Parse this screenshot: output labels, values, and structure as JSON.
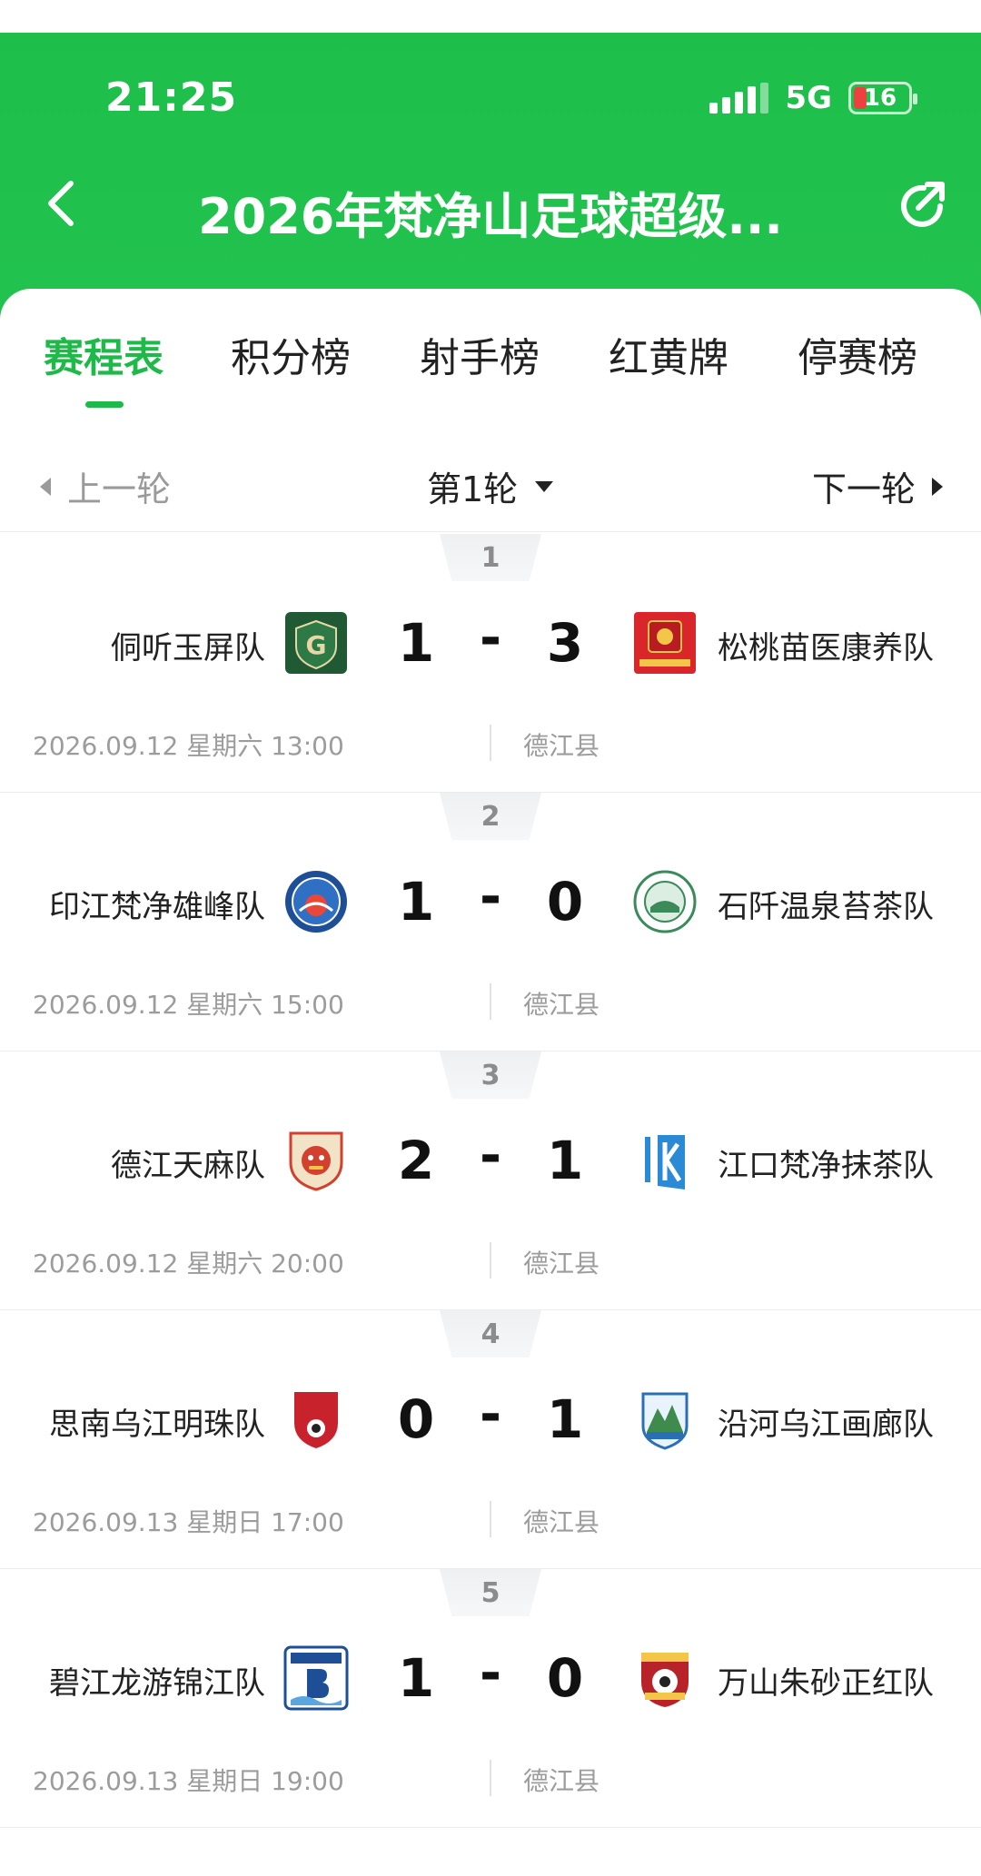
{
  "status_bar": {
    "time": "21:25",
    "network": "5G",
    "battery": "16"
  },
  "nav": {
    "title": "2026年梵净山足球超级..."
  },
  "tabs": [
    {
      "label": "赛程表",
      "active": true
    },
    {
      "label": "积分榜",
      "active": false
    },
    {
      "label": "射手榜",
      "active": false
    },
    {
      "label": "红黄牌",
      "active": false
    },
    {
      "label": "停赛榜",
      "active": false
    }
  ],
  "round_nav": {
    "prev": "上一轮",
    "current": "第1轮",
    "next": "下一轮"
  },
  "matches": [
    {
      "no": "1",
      "home": "侗听玉屏队",
      "home_score": "1",
      "dash": "-",
      "away_score": "3",
      "away": "松桃苗医康养队",
      "datetime": "2026.09.12 星期六 13:00",
      "venue": "德江县",
      "home_logo": "green-crest-icon",
      "away_logo": "red-banner-icon"
    },
    {
      "no": "2",
      "home": "印江梵净雄峰队",
      "home_score": "1",
      "dash": "-",
      "away_score": "0",
      "away": "石阡温泉苔茶队",
      "datetime": "2026.09.12 星期六 15:00",
      "venue": "德江县",
      "home_logo": "blue-round-badge-icon",
      "away_logo": "green-round-badge-icon"
    },
    {
      "no": "3",
      "home": "德江天麻队",
      "home_score": "2",
      "dash": "-",
      "away_score": "1",
      "away": "江口梵净抹茶队",
      "datetime": "2026.09.12 星期六 20:00",
      "venue": "德江县",
      "home_logo": "lion-shield-icon",
      "away_logo": "blue-k-icon"
    },
    {
      "no": "4",
      "home": "思南乌江明珠队",
      "home_score": "0",
      "dash": "-",
      "away_score": "1",
      "away": "沿河乌江画廊队",
      "datetime": "2026.09.13 星期日 17:00",
      "venue": "德江县",
      "home_logo": "cfa-shield-icon",
      "away_logo": "mountain-shield-icon"
    },
    {
      "no": "5",
      "home": "碧江龙游锦江队",
      "home_score": "1",
      "dash": "-",
      "away_score": "0",
      "away": "万山朱砂正红队",
      "datetime": "2026.09.13 星期日 19:00",
      "venue": "德江县",
      "home_logo": "blue-b-icon",
      "away_logo": "wsfa-ball-icon"
    }
  ],
  "colors": {
    "brand_green": "#1fb94a",
    "header_green": "#21c04d"
  }
}
